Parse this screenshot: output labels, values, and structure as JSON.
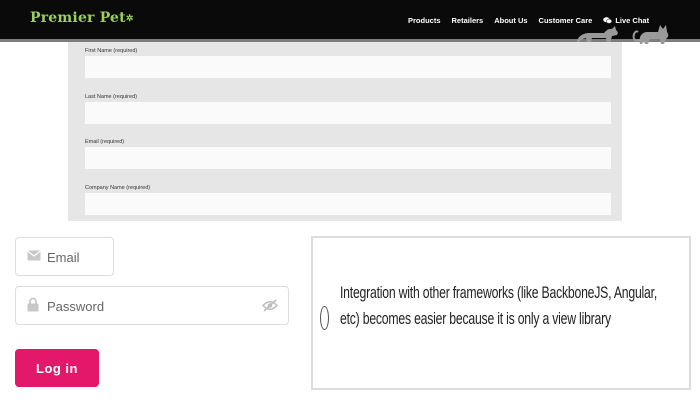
{
  "header": {
    "logo": "Premier Pet",
    "nav": [
      "Products",
      "Retailers",
      "About Us",
      "Customer Care"
    ],
    "live_chat": "Live Chat"
  },
  "contact_form": {
    "fields": [
      {
        "label": "First Name (required)",
        "value": ""
      },
      {
        "label": "Last Name (required)",
        "value": ""
      },
      {
        "label": "Email (required)",
        "value": ""
      },
      {
        "label": "Company Name (required)",
        "value": ""
      }
    ]
  },
  "login": {
    "email_placeholder": "Email",
    "password_placeholder": "Password",
    "submit_label": "Log in",
    "accent_color": "#e4186a"
  },
  "quiz_option": {
    "text": "Integration with other frameworks (like BackboneJS, Angular, etc) becomes easier because it is only a view library",
    "selected": false
  },
  "colors": {
    "header_bg": "#0a0a0a",
    "logo": "#9bd05a",
    "form_bg": "#e6e6e6"
  }
}
